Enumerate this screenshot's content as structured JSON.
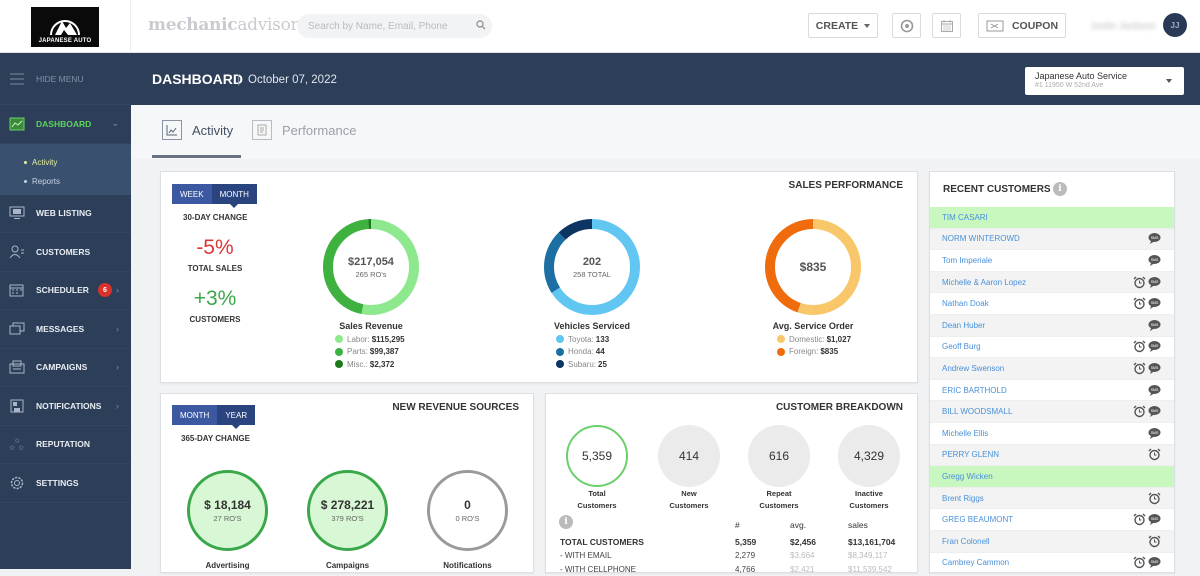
{
  "topbar": {
    "logo_text": "JAPANESE AUTO",
    "brand_bold": "mechanic",
    "brand_light": "advisor",
    "search_placeholder": "Search by Name, Email, Phone",
    "create_label": "CREATE",
    "coupon_label": "COUPON",
    "user_name": "Justin Jackson",
    "user_initials": "JJ"
  },
  "sidebar": {
    "hide_menu": "HIDE MENU",
    "items": [
      {
        "label": "DASHBOARD",
        "icon": "dashboard-icon",
        "active": true
      },
      {
        "label": "WEB LISTING",
        "icon": "web-listing-icon"
      },
      {
        "label": "CUSTOMERS",
        "icon": "customers-icon"
      },
      {
        "label": "SCHEDULER",
        "icon": "scheduler-icon",
        "badge": "6"
      },
      {
        "label": "MESSAGES",
        "icon": "messages-icon"
      },
      {
        "label": "CAMPAIGNS",
        "icon": "campaigns-icon"
      },
      {
        "label": "NOTIFICATIONS",
        "icon": "notifications-icon"
      },
      {
        "label": "REPUTATION",
        "icon": "reputation-icon"
      },
      {
        "label": "SETTINGS",
        "icon": "settings-icon"
      }
    ],
    "submenu": [
      "Activity",
      "Reports"
    ]
  },
  "header": {
    "title": "DASHBOARD",
    "separator": "|",
    "date": "October 07, 2022",
    "location_name": "Japanese Auto Service",
    "location_address": "#1 11950 W 52nd Ave"
  },
  "tabs": [
    {
      "label": "Activity",
      "active": true
    },
    {
      "label": "Performance",
      "active": false
    }
  ],
  "sales_performance": {
    "title": "SALES PERFORMANCE",
    "toggle": [
      "WEEK",
      "MONTH"
    ],
    "toggle_active": "MONTH",
    "change_label": "30-DAY CHANGE",
    "total_sales_pct": "-5%",
    "total_sales_label": "TOTAL SALES",
    "customers_pct": "+3%",
    "customers_label": "CUSTOMERS",
    "donuts": [
      {
        "title": "Sales Revenue",
        "center_main": "$217,054",
        "center_sub": "265 RO's",
        "segments": [
          {
            "label": "Labor",
            "value_text": "$115,295",
            "value": 115295,
            "color": "#8ee88e"
          },
          {
            "label": "Parts",
            "value_text": "$99,387",
            "value": 99387,
            "color": "#3fb13f"
          },
          {
            "label": "Misc.",
            "value_text": "$2,372",
            "value": 2372,
            "color": "#1d7a1d"
          }
        ]
      },
      {
        "title": "Vehicles Serviced",
        "center_main": "202",
        "center_sub": "258 TOTAL",
        "segments": [
          {
            "label": "Toyota",
            "value_text": "133",
            "value": 133,
            "color": "#62c6f2"
          },
          {
            "label": "Honda",
            "value_text": "44",
            "value": 44,
            "color": "#1d6fa3"
          },
          {
            "label": "Subaru",
            "value_text": "25",
            "value": 25,
            "color": "#0c3563"
          }
        ]
      },
      {
        "title": "Avg. Service Order",
        "center_main": "$835",
        "center_sub": "",
        "segments": [
          {
            "label": "Domestic",
            "value_text": "$1,027",
            "value": 1027,
            "color": "#f8c76a"
          },
          {
            "label": "Foreign",
            "value_text": "$835",
            "value": 835,
            "color": "#ef6b0c"
          }
        ]
      }
    ]
  },
  "revenue_sources": {
    "title": "NEW REVENUE SOURCES",
    "toggle": [
      "MONTH",
      "YEAR"
    ],
    "toggle_active": "YEAR",
    "change_label": "365-DAY CHANGE",
    "items": [
      {
        "label": "Advertising",
        "value": "$ 18,184",
        "sub": "27 RO'S",
        "state": "active"
      },
      {
        "label": "Campaigns",
        "value": "$ 278,221",
        "sub": "379 RO'S",
        "state": "active"
      },
      {
        "label": "Notifications",
        "value": "0",
        "sub": "0 RO'S",
        "state": "inactive"
      }
    ]
  },
  "customer_breakdown": {
    "title": "CUSTOMER BREAKDOWN",
    "circles": [
      {
        "value": "5,359",
        "label1": "Total",
        "label2": "Customers"
      },
      {
        "value": "414",
        "label1": "New",
        "label2": "Customers"
      },
      {
        "value": "616",
        "label1": "Repeat",
        "label2": "Customers"
      },
      {
        "value": "4,329",
        "label1": "Inactive",
        "label2": "Customers"
      }
    ],
    "table_headers": [
      "#",
      "avg.",
      "sales"
    ],
    "rows": [
      {
        "label": "TOTAL CUSTOMERS",
        "count": "5,359",
        "avg": "$2,456",
        "sales": "$13,161,704",
        "bold": true
      },
      {
        "label": "- WITH EMAIL",
        "count": "2,279",
        "avg": "$3,664",
        "sales": "$8,349,117"
      },
      {
        "label": "- WITH CELLPHONE",
        "count": "4,766",
        "avg": "$2,421",
        "sales": "$11,539,542"
      }
    ]
  },
  "recent_customers": {
    "title": "RECENT CUSTOMERS",
    "items": [
      {
        "name": "TIM CASARI",
        "alarm": false,
        "sms": false,
        "highlight": true
      },
      {
        "name": "NORM WINTEROWD",
        "alarm": false,
        "sms": true
      },
      {
        "name": "Tom Imperiale",
        "alarm": false,
        "sms": true
      },
      {
        "name": "Michelle & Aaron Lopez",
        "alarm": true,
        "sms": true
      },
      {
        "name": "Nathan Doak",
        "alarm": true,
        "sms": true
      },
      {
        "name": "Dean Huber",
        "alarm": false,
        "sms": true
      },
      {
        "name": "Geoff Burg",
        "alarm": true,
        "sms": true
      },
      {
        "name": "Andrew Swenson",
        "alarm": true,
        "sms": true
      },
      {
        "name": "ERIC BARTHOLD",
        "alarm": false,
        "sms": true
      },
      {
        "name": "BILL WOODSMALL",
        "alarm": true,
        "sms": true
      },
      {
        "name": "Michelle Ellis",
        "alarm": false,
        "sms": true
      },
      {
        "name": "PERRY GLENN",
        "alarm": true,
        "sms": false
      },
      {
        "name": "Gregg Wicken",
        "alarm": false,
        "sms": false,
        "highlight": true
      },
      {
        "name": "Brent Riggs",
        "alarm": true,
        "sms": false
      },
      {
        "name": "GREG BEAUMONT",
        "alarm": true,
        "sms": true
      },
      {
        "name": "Fran Colonell",
        "alarm": true,
        "sms": false
      },
      {
        "name": "Cambrey Cammon",
        "alarm": true,
        "sms": true
      }
    ]
  },
  "colors": {
    "nav_bg": "#2c3e58",
    "active_green": "#5fd35f",
    "negative": "#d9383a",
    "positive": "#3aa84a",
    "toggle_blue": "#3c58a0",
    "link_blue": "#4a90d9",
    "highlight_row": "#c8f7c0"
  }
}
